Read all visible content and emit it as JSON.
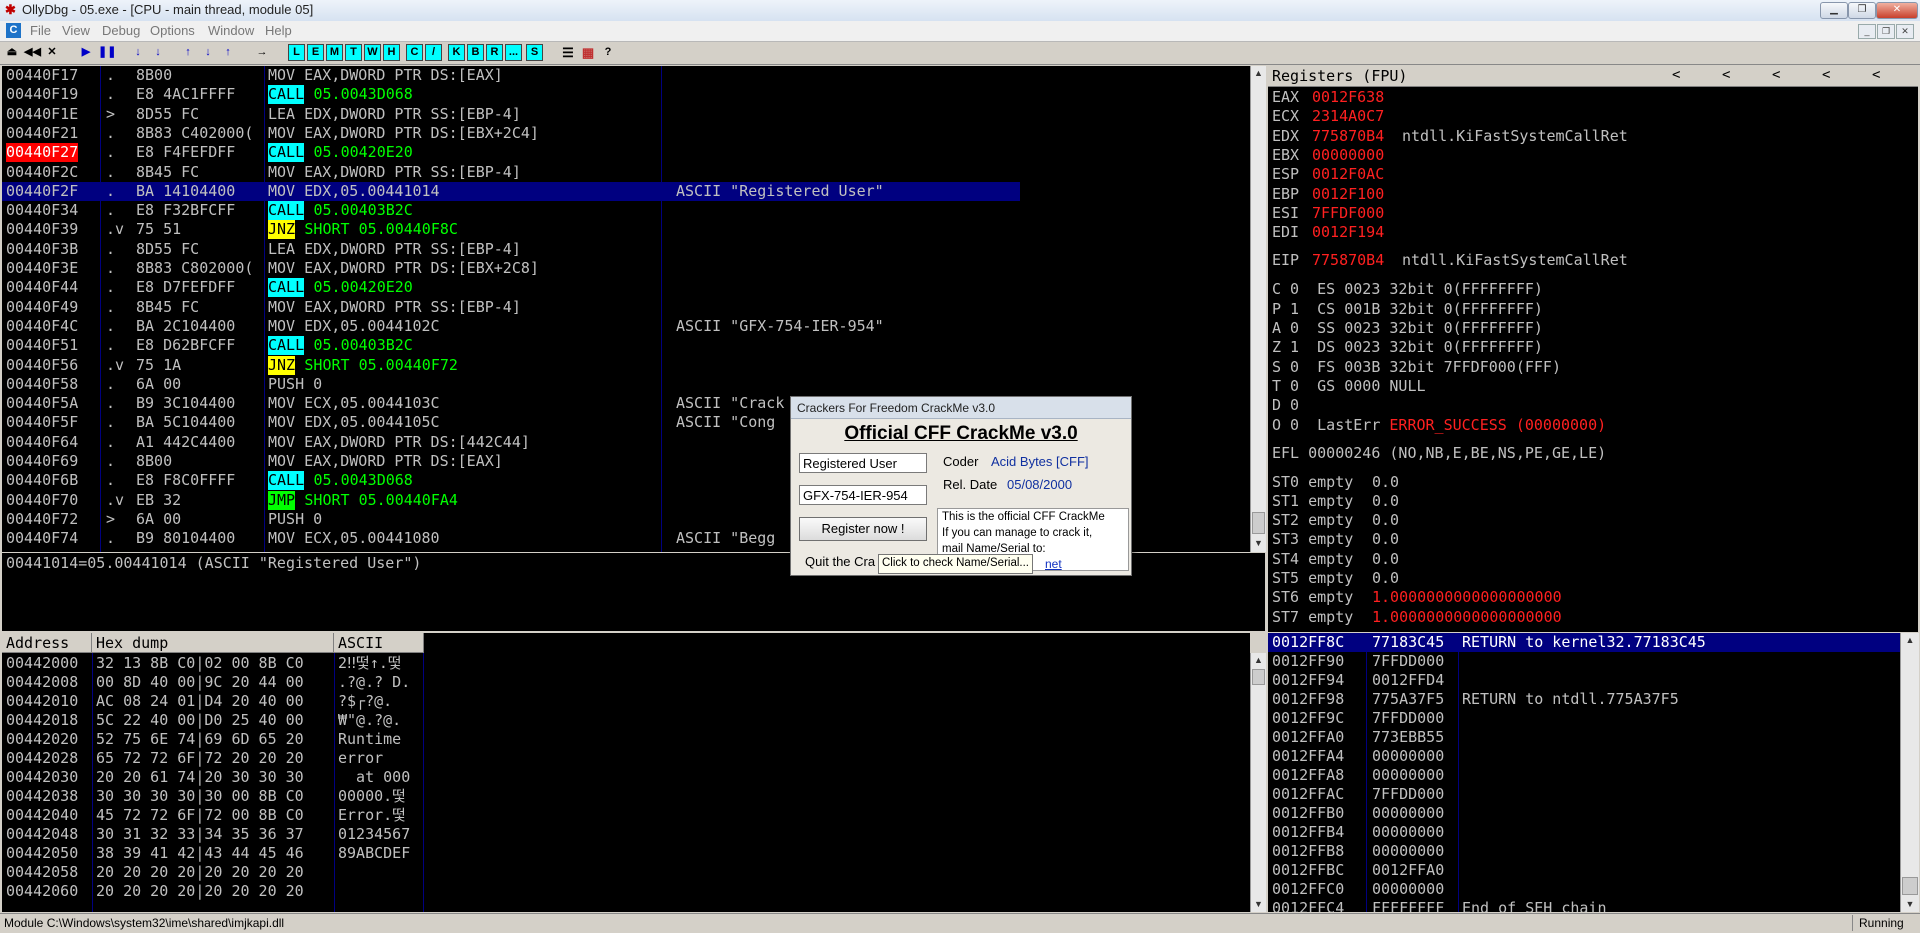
{
  "window": {
    "title": "OllyDbg - 05.exe - [CPU - main thread, module 05]"
  },
  "menu": [
    "File",
    "View",
    "Debug",
    "Options",
    "Window",
    "Help"
  ],
  "toolbar": {
    "letters": [
      "L",
      "E",
      "M",
      "T",
      "W",
      "H",
      "C",
      "/",
      "K",
      "B",
      "R",
      "...",
      "S"
    ],
    "glyphs": [
      "⏏",
      "◀◀",
      "✕",
      "▶",
      "❚❚",
      "↓",
      "↓",
      "↑",
      "↓",
      "↑",
      "→"
    ]
  },
  "disasm": {
    "rows": [
      {
        "addr": "00440F17",
        "mark": ".",
        "hex": "8B00",
        "instr": "MOV EAX,DWORD PTR DS:[EAX]",
        "comment": ""
      },
      {
        "addr": "00440F19",
        "mark": ".",
        "hex": "E8 4AC1FFFF",
        "op": "CALL",
        "arg": "05.0043D068",
        "kind": "call",
        "comment": ""
      },
      {
        "addr": "00440F1E",
        "mark": ">",
        "hex": "8D55 FC",
        "instr": "LEA EDX,DWORD PTR SS:[EBP-4]",
        "comment": ""
      },
      {
        "addr": "00440F21",
        "mark": ".",
        "hex": "8B83 C402000(",
        "instr": "MOV EAX,DWORD PTR DS:[EBX+2C4]",
        "comment": ""
      },
      {
        "addr": "00440F27",
        "mark": ".",
        "hex": "E8 F4FEFDFF",
        "op": "CALL",
        "arg": "05.00420E20",
        "kind": "call",
        "bp": true,
        "comment": ""
      },
      {
        "addr": "00440F2C",
        "mark": ".",
        "hex": "8B45 FC",
        "instr": "MOV EAX,DWORD PTR SS:[EBP-4]",
        "comment": ""
      },
      {
        "addr": "00440F2F",
        "mark": ".",
        "hex": "BA 14104400",
        "instr": "MOV EDX,05.00441014",
        "comment": "ASCII \"Registered User\"",
        "selected": true
      },
      {
        "addr": "00440F34",
        "mark": ".",
        "hex": "E8 F32BFCFF",
        "op": "CALL",
        "arg": "05.00403B2C",
        "kind": "call",
        "comment": ""
      },
      {
        "addr": "00440F39",
        "mark": ".v",
        "hex": "75 51",
        "op": "JNZ",
        "arg": "SHORT 05.00440F8C",
        "kind": "jnz",
        "comment": ""
      },
      {
        "addr": "00440F3B",
        "mark": ".",
        "hex": "8D55 FC",
        "instr": "LEA EDX,DWORD PTR SS:[EBP-4]",
        "comment": ""
      },
      {
        "addr": "00440F3E",
        "mark": ".",
        "hex": "8B83 C802000(",
        "instr": "MOV EAX,DWORD PTR DS:[EBX+2C8]",
        "comment": ""
      },
      {
        "addr": "00440F44",
        "mark": ".",
        "hex": "E8 D7FEFDFF",
        "op": "CALL",
        "arg": "05.00420E20",
        "kind": "call",
        "comment": ""
      },
      {
        "addr": "00440F49",
        "mark": ".",
        "hex": "8B45 FC",
        "instr": "MOV EAX,DWORD PTR SS:[EBP-4]",
        "comment": ""
      },
      {
        "addr": "00440F4C",
        "mark": ".",
        "hex": "BA 2C104400",
        "instr": "MOV EDX,05.0044102C",
        "comment": "ASCII \"GFX-754-IER-954\""
      },
      {
        "addr": "00440F51",
        "mark": ".",
        "hex": "E8 D62BFCFF",
        "op": "CALL",
        "arg": "05.00403B2C",
        "kind": "call",
        "comment": ""
      },
      {
        "addr": "00440F56",
        "mark": ".v",
        "hex": "75 1A",
        "op": "JNZ",
        "arg": "SHORT 05.00440F72",
        "kind": "jnz",
        "comment": ""
      },
      {
        "addr": "00440F58",
        "mark": ".",
        "hex": "6A 00",
        "instr": "PUSH 0",
        "comment": ""
      },
      {
        "addr": "00440F5A",
        "mark": ".",
        "hex": "B9 3C104400",
        "instr": "MOV ECX,05.0044103C",
        "comment": "ASCII \"Crack"
      },
      {
        "addr": "00440F5F",
        "mark": ".",
        "hex": "BA 5C104400",
        "instr": "MOV EDX,05.0044105C",
        "comment": "ASCII \"Cong"
      },
      {
        "addr": "00440F64",
        "mark": ".",
        "hex": "A1 442C4400",
        "instr": "MOV EAX,DWORD PTR DS:[442C44]",
        "comment": ""
      },
      {
        "addr": "00440F69",
        "mark": ".",
        "hex": "8B00",
        "instr": "MOV EAX,DWORD PTR DS:[EAX]",
        "comment": ""
      },
      {
        "addr": "00440F6B",
        "mark": ".",
        "hex": "E8 F8C0FFFF",
        "op": "CALL",
        "arg": "05.0043D068",
        "kind": "call",
        "comment": ""
      },
      {
        "addr": "00440F70",
        "mark": ".v",
        "hex": "EB 32",
        "op": "JMP",
        "arg": "SHORT 05.00440FA4",
        "kind": "jmp",
        "comment": ""
      },
      {
        "addr": "00440F72",
        "mark": ">",
        "hex": "6A 00",
        "instr": "PUSH 0",
        "comment": ""
      },
      {
        "addr": "00440F74",
        "mark": ".",
        "hex": "B9 80104400",
        "instr": "MOV ECX,05.00441080",
        "comment": "ASCII \"Begg"
      }
    ]
  },
  "info_line": "00441014=05.00441014 (ASCII \"Registered User\")",
  "registers": {
    "title": "Registers (FPU)",
    "nav": [
      "<",
      "<",
      "<",
      "<",
      "<"
    ],
    "gp": [
      {
        "name": "EAX",
        "value": "0012F638",
        "note": ""
      },
      {
        "name": "ECX",
        "value": "2314A0C7",
        "note": ""
      },
      {
        "name": "EDX",
        "value": "775870B4",
        "note": "ntdll.KiFastSystemCallRet"
      },
      {
        "name": "EBX",
        "value": "00000000",
        "note": ""
      },
      {
        "name": "ESP",
        "value": "0012F0AC",
        "note": ""
      },
      {
        "name": "EBP",
        "value": "0012F100",
        "note": ""
      },
      {
        "name": "ESI",
        "value": "7FFDF000",
        "note": ""
      },
      {
        "name": "EDI",
        "value": "0012F194",
        "note": ""
      }
    ],
    "eip": {
      "name": "EIP",
      "value": "775870B4",
      "note": "ntdll.KiFastSystemCallRet"
    },
    "flags": [
      "C 0  ES 0023 32bit 0(FFFFFFFF)",
      "P 1  CS 001B 32bit 0(FFFFFFFF)",
      "A 0  SS 0023 32bit 0(FFFFFFFF)",
      "Z 1  DS 0023 32bit 0(FFFFFFFF)",
      "S 0  FS 003B 32bit 7FFDF000(FFF)",
      "T 0  GS 0000 NULL",
      "D 0"
    ],
    "lasterr_prefix": "O 0  LastErr ",
    "lasterr_value": "ERROR_SUCCESS (00000000)",
    "efl": "EFL 00000246 (NO,NB,E,BE,NS,PE,GE,LE)",
    "fpu": [
      {
        "label": "ST0 empty",
        "value": "0.0",
        "red": false
      },
      {
        "label": "ST1 empty",
        "value": "0.0",
        "red": false
      },
      {
        "label": "ST2 empty",
        "value": "0.0",
        "red": false
      },
      {
        "label": "ST3 empty",
        "value": "0.0",
        "red": false
      },
      {
        "label": "ST4 empty",
        "value": "0.0",
        "red": false
      },
      {
        "label": "ST5 empty",
        "value": "0.0",
        "red": false
      },
      {
        "label": "ST6 empty",
        "value": "1.0000000000000000000",
        "red": true
      },
      {
        "label": "ST7 empty",
        "value": "1.0000000000000000000",
        "red": true
      }
    ]
  },
  "dump": {
    "headers": [
      "Address",
      "Hex dump",
      "ASCII"
    ],
    "rows": [
      {
        "addr": "00442000",
        "hex": "32 13 8B C0|02 00 8B C0",
        "ascii": "2‼떷↑.떷"
      },
      {
        "addr": "00442008",
        "hex": "00 8D 40 00|9C 20 44 00",
        "ascii": ".?@.? D."
      },
      {
        "addr": "00442010",
        "hex": "AC 08 24 01|D4 20 40 00",
        "ascii": "?$┌?@."
      },
      {
        "addr": "00442018",
        "hex": "5C 22 40 00|D0 25 40 00",
        "ascii": "₩\"@.?@."
      },
      {
        "addr": "00442020",
        "hex": "52 75 6E 74|69 6D 65 20",
        "ascii": "Runtime "
      },
      {
        "addr": "00442028",
        "hex": "65 72 72 6F|72 20 20 20",
        "ascii": "error   "
      },
      {
        "addr": "00442030",
        "hex": "20 20 61 74|20 30 30 30",
        "ascii": "  at 000"
      },
      {
        "addr": "00442038",
        "hex": "30 30 30 30|30 00 8B C0",
        "ascii": "00000.떷"
      },
      {
        "addr": "00442040",
        "hex": "45 72 72 6F|72 00 8B C0",
        "ascii": "Error.떷"
      },
      {
        "addr": "00442048",
        "hex": "30 31 32 33|34 35 36 37",
        "ascii": "01234567"
      },
      {
        "addr": "00442050",
        "hex": "38 39 41 42|43 44 45 46",
        "ascii": "89ABCDEF"
      },
      {
        "addr": "00442058",
        "hex": "20 20 20 20|20 20 20 20",
        "ascii": "        "
      },
      {
        "addr": "00442060",
        "hex": "20 20 20 20|20 20 20 20",
        "ascii": "        "
      }
    ]
  },
  "stack": {
    "rows": [
      {
        "addr": "0012FF8C",
        "value": "77183C45",
        "note": "RETURN to kernel32.77183C45",
        "selected": true
      },
      {
        "addr": "0012FF90",
        "value": "7FFDD000",
        "note": ""
      },
      {
        "addr": "0012FF94",
        "value": "0012FFD4",
        "note": ""
      },
      {
        "addr": "0012FF98",
        "value": "775A37F5",
        "note": "RETURN to ntdll.775A37F5"
      },
      {
        "addr": "0012FF9C",
        "value": "7FFDD000",
        "note": ""
      },
      {
        "addr": "0012FFA0",
        "value": "773EBB55",
        "note": ""
      },
      {
        "addr": "0012FFA4",
        "value": "00000000",
        "note": ""
      },
      {
        "addr": "0012FFA8",
        "value": "00000000",
        "note": ""
      },
      {
        "addr": "0012FFAC",
        "value": "7FFDD000",
        "note": ""
      },
      {
        "addr": "0012FFB0",
        "value": "00000000",
        "note": ""
      },
      {
        "addr": "0012FFB4",
        "value": "00000000",
        "note": ""
      },
      {
        "addr": "0012FFB8",
        "value": "00000000",
        "note": ""
      },
      {
        "addr": "0012FFBC",
        "value": "0012FFA0",
        "note": ""
      },
      {
        "addr": "0012FFC0",
        "value": "00000000",
        "note": ""
      },
      {
        "addr": "0012FFC4",
        "value": "FFFFFFFF",
        "note": "End of SEH chain"
      }
    ]
  },
  "dialog": {
    "title": "Crackers For Freedom CrackMe v3.0",
    "heading": "Official CFF CrackMe v3.0",
    "name_value": "Registered User",
    "serial_value": "GFX-754-IER-954",
    "coder_label": "Coder",
    "coder_value": "Acid Bytes [CFF]",
    "reldate_label": "Rel. Date",
    "reldate_value": "05/08/2000",
    "register_button": "Register now !",
    "quit_button": "Quit the Cra",
    "info": [
      "This is the official CFF CrackMe",
      "If you can manage to crack it,",
      "mail Name/Serial to:"
    ],
    "link": "net",
    "tooltip": "Click to check Name/Serial..."
  },
  "status": {
    "module": "Module C:\\Windows\\system32\\ime\\shared\\imjkapi.dll",
    "state": "Running"
  }
}
